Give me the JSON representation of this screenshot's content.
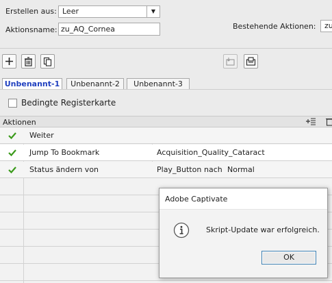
{
  "form": {
    "create_from_label": "Erstellen aus:",
    "create_from_value": "Leer",
    "action_name_label": "Aktionsname:",
    "action_name_value": "zu_AQ_Cornea",
    "existing_actions_label": "Bestehende Aktionen:",
    "existing_actions_value": "zu"
  },
  "tabs": [
    "Unbenannt-1",
    "Unbenannt-2",
    "Unbenannt-3"
  ],
  "conditional_tab_label": "Bedingte Registerkarte",
  "grid": {
    "header": "Aktionen",
    "rows": [
      {
        "action": "Weiter",
        "param": "",
        "param2": "",
        "param3": ""
      },
      {
        "action": "Jump To Bookmark",
        "param": "Acquisition_Quality_Cataract",
        "param2": "",
        "param3": ""
      },
      {
        "action": "Status ändern von",
        "param": "Play_Button",
        "param2": "nach",
        "param3": "Normal"
      }
    ]
  },
  "dialog": {
    "title": "Adobe Captivate",
    "message": "Skript-Update war erfolgreich.",
    "ok_label": "OK"
  },
  "colors": {
    "active_tab_text": "#1f3fbf",
    "check_green": "#3a9a1a",
    "ok_border": "#3c7fb1"
  }
}
